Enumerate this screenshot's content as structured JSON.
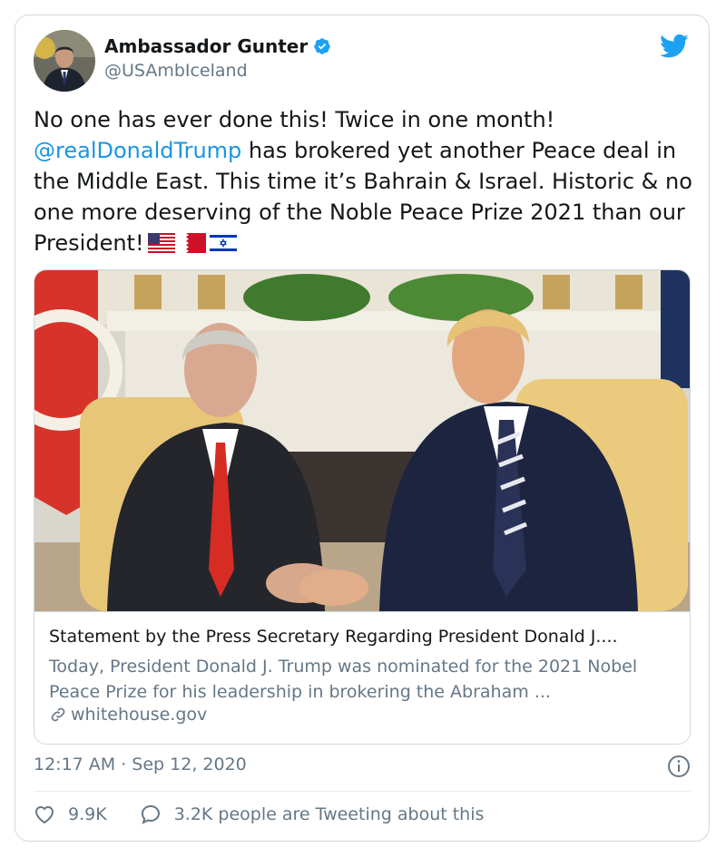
{
  "author": {
    "name": "Ambassador Gunter",
    "handle": "@USAmbIceland"
  },
  "tweet": {
    "text_before": "No one has ever done this! Twice in one month! ",
    "mention": "@realDonaldTrump",
    "text_after": " has brokered yet another Peace deal in the Middle East. This time it’s Bahrain & Israel. Historic & no one more deserving of the Noble Peace Prize 2021 than our President!",
    "flags": [
      "us-flag-icon",
      "bahrain-flag-icon",
      "israel-flag-icon"
    ]
  },
  "link_card": {
    "title": "Statement by the Press Secretary Regarding President Donald J....",
    "description": "Today, President Donald J. Trump was nominated for the 2021 Nobel Peace Prize for his leadership in brokering the Abraham ...",
    "domain": "whitehouse.gov"
  },
  "meta": {
    "timestamp": "12:17 AM · Sep 12, 2020"
  },
  "actions": {
    "likes": "9.9K",
    "tweeting": "3.2K people are Tweeting about this"
  },
  "colors": {
    "twitter_blue": "#1da1f2",
    "mention_blue": "#1b95e0",
    "secondary_text": "#657786",
    "border": "#cfd9de"
  }
}
